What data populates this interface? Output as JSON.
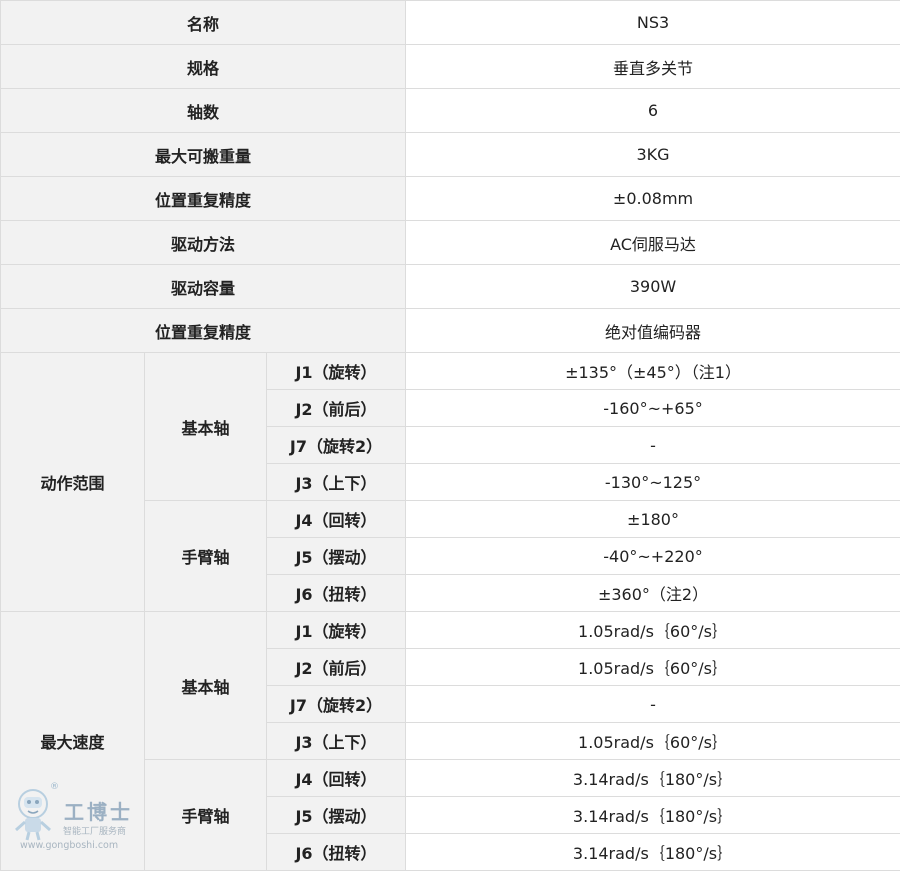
{
  "spec": {
    "basic": [
      {
        "label": "名称",
        "value": "NS3"
      },
      {
        "label": "规格",
        "value": "垂直多关节"
      },
      {
        "label": "轴数",
        "value": "6"
      },
      {
        "label": "最大可搬重量",
        "value": "3KG"
      },
      {
        "label": "位置重复精度",
        "value": "±0.08mm"
      },
      {
        "label": "驱动方法",
        "value": "AC伺服马达"
      },
      {
        "label": "驱动容量",
        "value": "390W"
      },
      {
        "label": "位置重复精度",
        "value": "绝对值编码器"
      }
    ],
    "motion_range": {
      "label": "动作范围",
      "basic_axis": {
        "label": "基本轴",
        "rows": [
          {
            "axis": "J1（旋转）",
            "value": "±135°（±45°）（注1）"
          },
          {
            "axis": "J2（前后）",
            "value": "-160°~+65°"
          },
          {
            "axis": "J7（旋转2）",
            "value": "-"
          },
          {
            "axis": "J3（上下）",
            "value": "-130°~125°"
          }
        ]
      },
      "arm_axis": {
        "label": "手臂轴",
        "rows": [
          {
            "axis": "J4（回转）",
            "value": "±180°"
          },
          {
            "axis": "J5（摆动）",
            "value": "-40°~+220°"
          },
          {
            "axis": "J6（扭转）",
            "value": "±360°（注2）"
          }
        ]
      }
    },
    "max_speed": {
      "label": "最大速度",
      "basic_axis": {
        "label": "基本轴",
        "rows": [
          {
            "axis": "J1（旋转）",
            "value": "1.05rad/s｛60°/s｝"
          },
          {
            "axis": "J2（前后）",
            "value": "1.05rad/s｛60°/s｝"
          },
          {
            "axis": "J7（旋转2）",
            "value": "-"
          },
          {
            "axis": "J3（上下）",
            "value": "1.05rad/s｛60°/s｝"
          }
        ]
      },
      "arm_axis": {
        "label": "手臂轴",
        "rows": [
          {
            "axis": "J4（回转）",
            "value": "3.14rad/s｛180°/s｝"
          },
          {
            "axis": "J5（摆动）",
            "value": "3.14rad/s｛180°/s｝"
          },
          {
            "axis": "J6（扭转）",
            "value": "3.14rad/s｛180°/s｝"
          }
        ]
      }
    }
  },
  "watermark": {
    "registered": "®",
    "name": "工博士",
    "slogan": "智能工厂服务商",
    "url": "www.gongboshi.com",
    "colors": {
      "text": "#9bb0c3",
      "figure": "#b8cfe0"
    },
    "icon": "robot-mascot-icon"
  }
}
